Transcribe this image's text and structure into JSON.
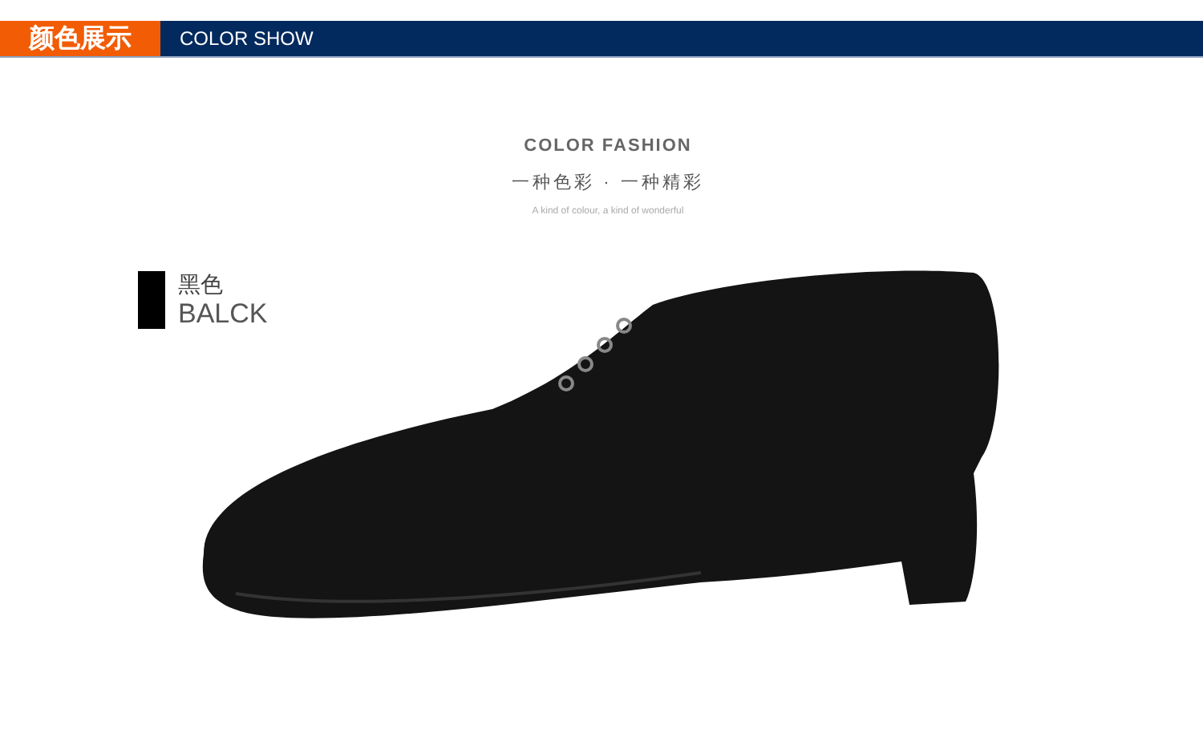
{
  "header": {
    "title": "颜色展示",
    "subtitle": "COLOR SHOW"
  },
  "heading": {
    "title": "COLOR FASHION",
    "tagline": "一种色彩 · 一种精彩",
    "caption": "A kind of colour, a kind of wonderful"
  },
  "colors": [
    {
      "name": "黑色",
      "name_en": "BALCK",
      "color": "#000000"
    }
  ]
}
